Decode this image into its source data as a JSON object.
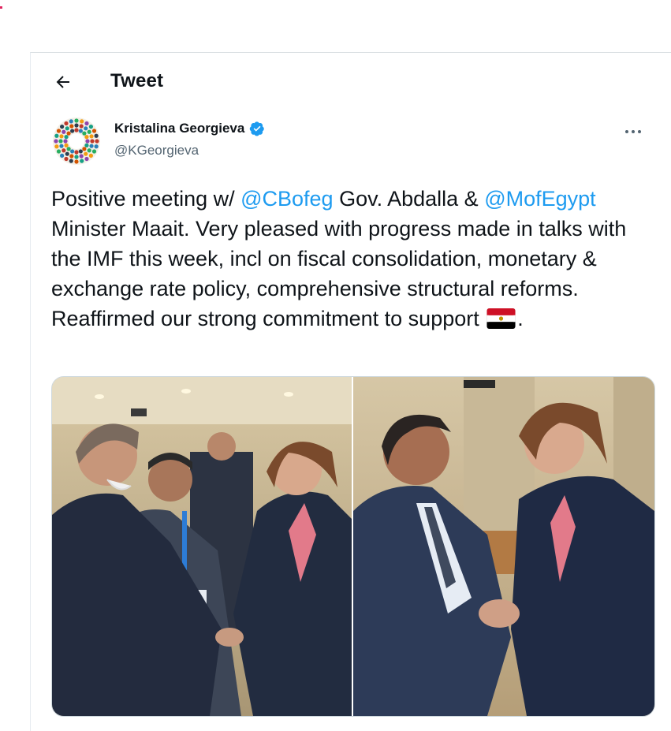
{
  "header": {
    "title": "Tweet",
    "back_icon": "arrow-left-icon"
  },
  "author": {
    "name": "Kristalina Georgieva",
    "handle": "@KGeorgieva",
    "verified": true,
    "avatar_icon": "imf-seal-avatar"
  },
  "tweet": {
    "text_1": "Positive meeting w/ ",
    "mention_1": "@CBofeg",
    "text_2": " Gov. Abdalla & ",
    "mention_2": "@MofEgypt",
    "text_3": " Minister Maait. Very pleased with progress made in talks with the IMF this week, incl on fiscal consolidation, monetary & exchange rate policy, comprehensive structural reforms. Reaffirmed our strong commitment to support ",
    "emoji": "egypt-flag",
    "text_4": "."
  },
  "media": {
    "photos": [
      {
        "name": "photo-handshake-group"
      },
      {
        "name": "photo-handshake-closeup"
      }
    ]
  },
  "colors": {
    "link": "#1d9bf0",
    "text": "#0f1419",
    "secondary": "#536471",
    "verified": "#1d9bf0"
  }
}
